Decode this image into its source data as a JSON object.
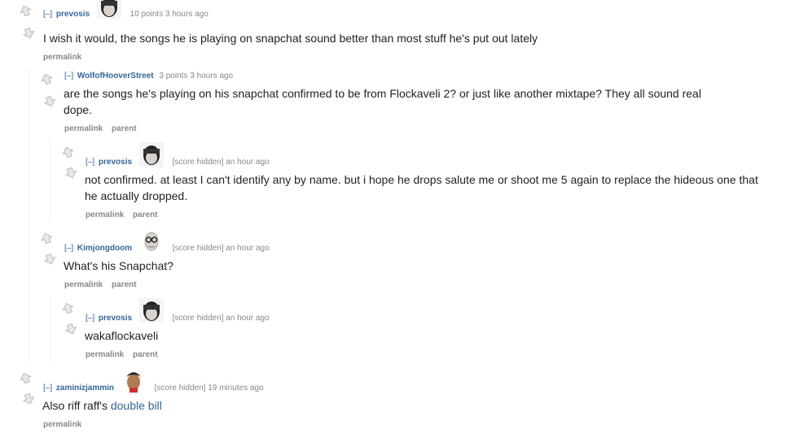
{
  "labels": {
    "toggle": "[–]",
    "permalink": "permalink",
    "parent": "parent"
  },
  "comments": [
    {
      "author": "prevosis",
      "meta": "10 points 3 hours ago",
      "avatar": "eminem-face-avatar",
      "body": "I wish it would, the songs he is playing on snapchat sound better than most stuff he's put out lately"
    },
    {
      "author": "WolfofHooverStreet",
      "meta": "3 points 3 hours ago",
      "body": "are the songs he's playing on his snapchat confirmed to be from Flockaveli 2? or just like another mixtape? They all sound real dope."
    },
    {
      "author": "prevosis",
      "meta": "[score hidden] an hour ago",
      "avatar": "eminem-face-avatar",
      "body": "not confirmed. at least I can't identify any by name. but i hope he drops salute me or shoot me 5 again to replace the hideous one that he actually dropped."
    },
    {
      "author": "Kimjongdoom",
      "meta": "[score hidden] an hour ago",
      "avatar": "glasses-face-avatar",
      "body": "What's his Snapchat?"
    },
    {
      "author": "prevosis",
      "meta": "[score hidden] an hour ago",
      "avatar": "eminem-face-avatar",
      "body": "wakaflockaveli"
    },
    {
      "author": "zaminizjammin",
      "meta": "[score hidden] 19 minutes ago",
      "avatar": "dark-hair-face-avatar",
      "body_prefix": "Also riff raff's ",
      "body_link": "double bill"
    }
  ]
}
